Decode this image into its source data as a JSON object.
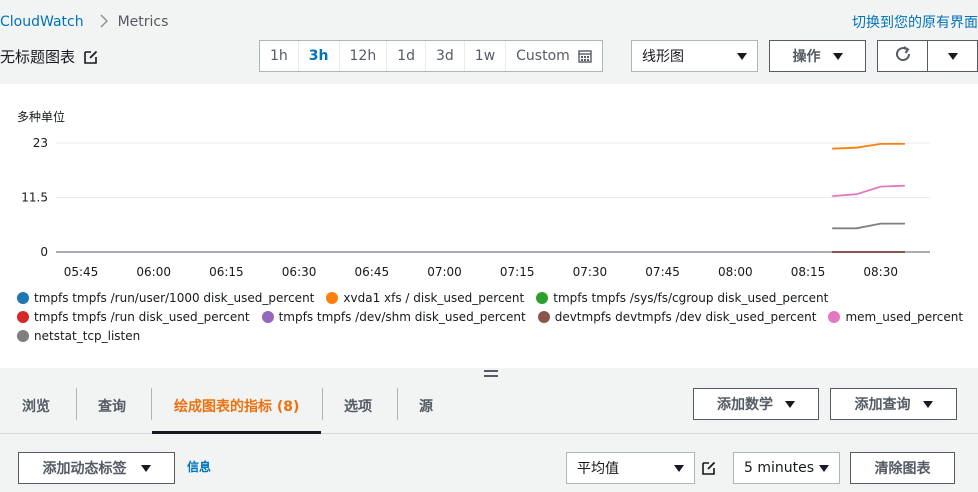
{
  "breadcrumb": {
    "root": "CloudWatch",
    "current": "Metrics"
  },
  "header": {
    "switch_link": "切换到您的原有界面",
    "title": "无标题图表"
  },
  "time_range": {
    "options": [
      "1h",
      "3h",
      "12h",
      "1d",
      "3d",
      "1w",
      "Custom"
    ],
    "selected": "3h"
  },
  "toolbar": {
    "chart_type": "线形图",
    "actions_label": "操作"
  },
  "chart": {
    "unit_label": "多种单位",
    "y_ticks": [
      "23",
      "11.5",
      "0"
    ],
    "x_ticks": [
      "05:45",
      "06:00",
      "06:15",
      "06:30",
      "06:45",
      "07:00",
      "07:15",
      "07:30",
      "07:45",
      "08:00",
      "08:15",
      "08:30"
    ]
  },
  "chart_data": {
    "type": "line",
    "ylabel": "多种单位",
    "ylim": [
      0,
      23
    ],
    "yticks": [
      0,
      11.5,
      23
    ],
    "xticks": [
      "05:45",
      "06:00",
      "06:15",
      "06:30",
      "06:45",
      "07:00",
      "07:15",
      "07:30",
      "07:45",
      "08:00",
      "08:15",
      "08:30"
    ],
    "grid": true,
    "legend_position": "bottom",
    "series": [
      {
        "name": "tmpfs tmpfs /run/user/1000 disk_used_percent",
        "color": "#1f77b4",
        "x": [
          "08:20",
          "08:25",
          "08:30",
          "08:35"
        ],
        "values": [
          0,
          0,
          0,
          0
        ]
      },
      {
        "name": "xvda1 xfs / disk_used_percent",
        "color": "#ff7f0e",
        "x": [
          "08:20",
          "08:25",
          "08:30",
          "08:35"
        ],
        "values": [
          21.8,
          22.0,
          22.8,
          22.8
        ]
      },
      {
        "name": "tmpfs tmpfs /sys/fs/cgroup disk_used_percent",
        "color": "#2ca02c",
        "x": [
          "08:20",
          "08:25",
          "08:30",
          "08:35"
        ],
        "values": [
          0,
          0,
          0,
          0
        ]
      },
      {
        "name": "tmpfs tmpfs /run disk_used_percent",
        "color": "#d62728",
        "x": [
          "08:20",
          "08:25",
          "08:30",
          "08:35"
        ],
        "values": [
          0,
          0,
          0,
          0
        ]
      },
      {
        "name": "tmpfs tmpfs /dev/shm disk_used_percent",
        "color": "#9467bd",
        "x": [
          "08:20",
          "08:25",
          "08:30",
          "08:35"
        ],
        "values": [
          0,
          0,
          0,
          0
        ]
      },
      {
        "name": "devtmpfs devtmpfs /dev disk_used_percent",
        "color": "#8c564b",
        "x": [
          "08:20",
          "08:25",
          "08:30",
          "08:35"
        ],
        "values": [
          0,
          0,
          0,
          0
        ]
      },
      {
        "name": "mem_used_percent",
        "color": "#e377c2",
        "x": [
          "08:20",
          "08:25",
          "08:30",
          "08:35"
        ],
        "values": [
          11.8,
          12.2,
          13.8,
          14.0
        ]
      },
      {
        "name": "netstat_tcp_listen",
        "color": "#7f7f7f",
        "x": [
          "08:20",
          "08:25",
          "08:30",
          "08:35"
        ],
        "values": [
          5,
          5,
          6,
          6
        ]
      }
    ]
  },
  "tabs": [
    {
      "label": "浏览"
    },
    {
      "label": "查询"
    },
    {
      "label": "绘成图表的指标 (8)"
    },
    {
      "label": "选项"
    },
    {
      "label": "源"
    }
  ],
  "metric_actions": {
    "add_math": "添加数学",
    "add_query": "添加查询"
  },
  "bottom": {
    "add_dynamic_label": "添加动态标签",
    "info": "信息",
    "statistic": "平均值",
    "period": "5 minutes",
    "clear_graph": "清除图表"
  }
}
